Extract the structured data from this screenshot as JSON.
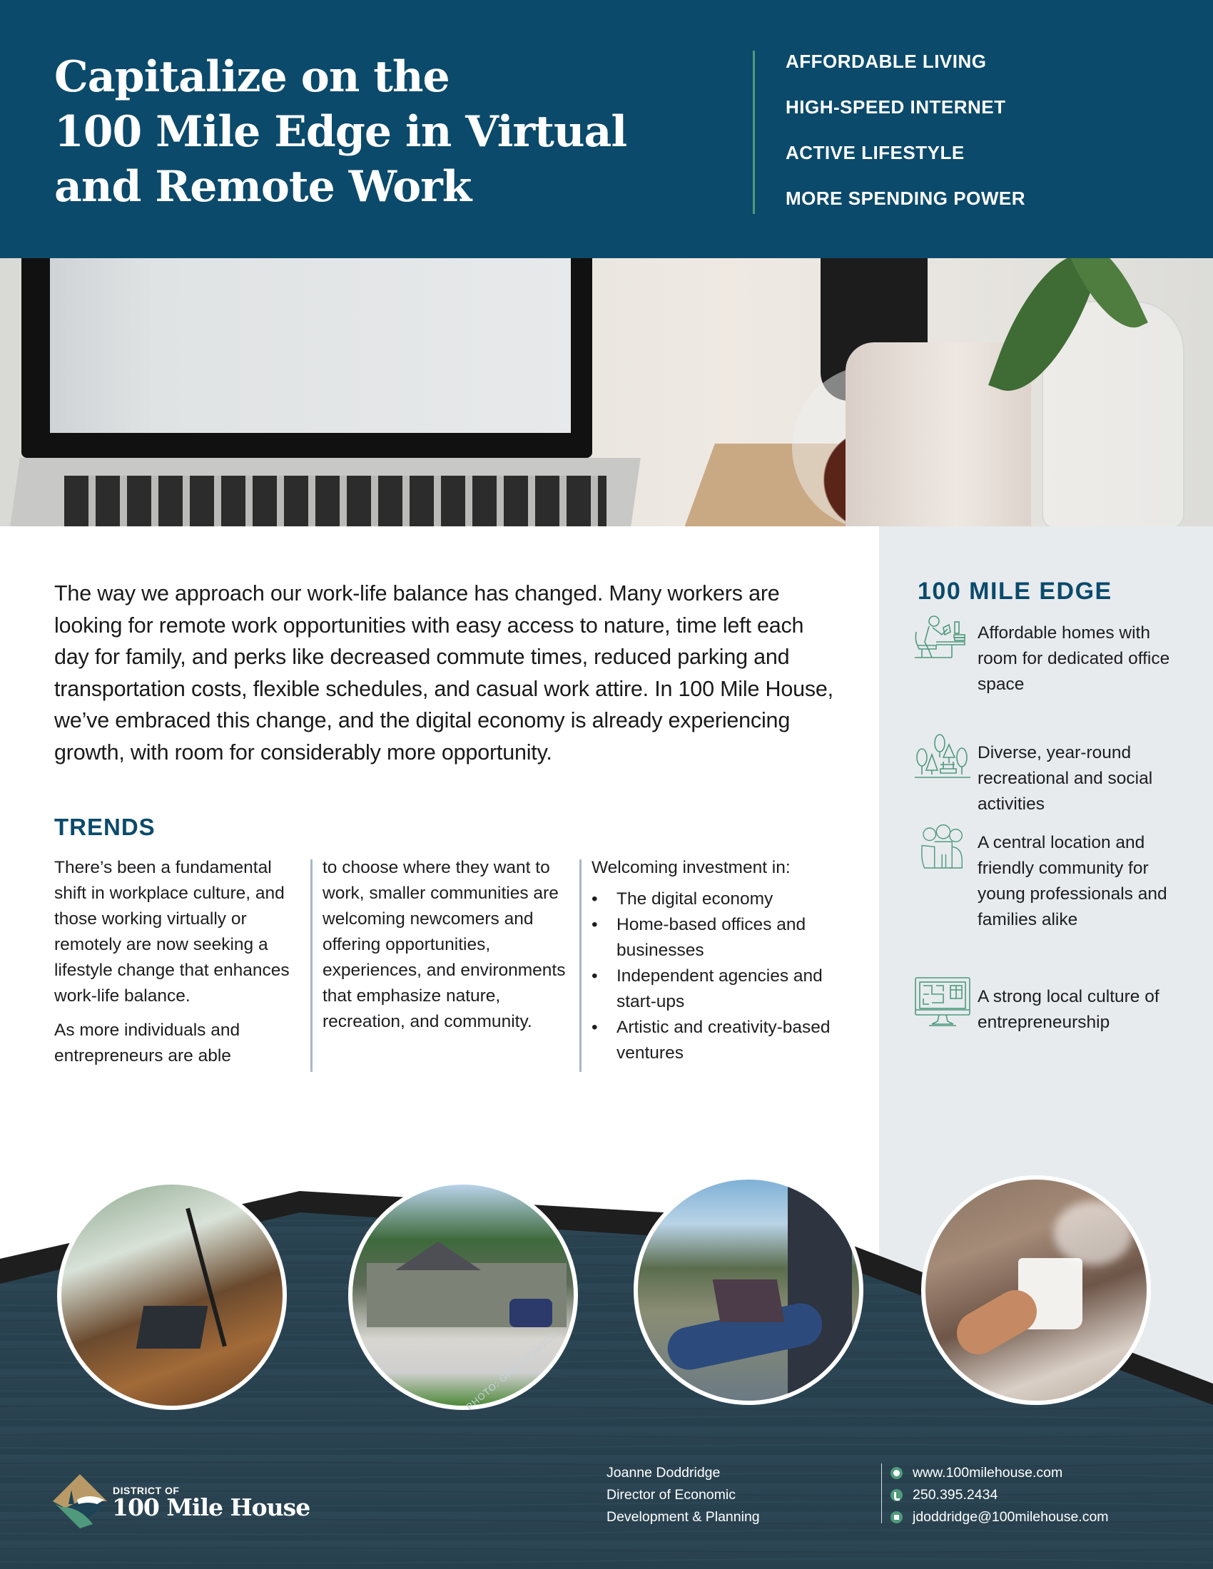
{
  "header": {
    "title_lines": [
      "Capitalize on the",
      "100 Mile Edge in Virtual",
      "and Remote Work"
    ],
    "tags": [
      "AFFORDABLE LIVING",
      "HIGH-SPEED INTERNET",
      "ACTIVE LIFESTYLE",
      "MORE SPENDING POWER"
    ],
    "colors": {
      "background": "#0b4a6b",
      "divider": "#4f9a7c"
    }
  },
  "hero": {
    "image": "laptop-coffee-desk-photo"
  },
  "intro": {
    "text": "The way we approach our work-life balance has changed. Many workers are looking for remote work opportunities with easy access to nature, time left each day for family, and perks like decreased commute times, reduced parking and transportation costs, flexible schedules, and casual work attire. In 100 Mile House, we’ve embraced this change, and the digital economy is already experiencing growth, with room for considerably more opportunity."
  },
  "trends": {
    "title": "TRENDS",
    "col1": [
      "There’s been a fundamental shift in workplace culture, and those working virtually or remotely are now seeking a lifestyle change that enhances work-life balance.",
      "As more individuals and entrepreneurs are able"
    ],
    "col2": "to choose where they want to work, smaller communities are welcoming newcomers and offering opportunities, experiences, and environments that emphasize nature, recreation, and community.",
    "col3": {
      "lead": "Welcoming investment in:",
      "items": [
        "The digital economy",
        "Home-based offices and businesses",
        "Independent agencies and start-ups",
        "Artistic and creativity-based ventures"
      ]
    }
  },
  "edge": {
    "title": "100 MILE EDGE",
    "items": [
      {
        "icon": "home-office-icon",
        "text": "Affordable homes with room for dedicated office space"
      },
      {
        "icon": "park-trees-icon",
        "text": "Diverse, year-round recreational and social activities"
      },
      {
        "icon": "family-icon",
        "text": "A central location and friendly community for young professionals and families alike"
      },
      {
        "icon": "computer-monitor-icon",
        "text": "A strong local culture of entrepreneurship"
      }
    ]
  },
  "photos": {
    "items": [
      "home-office-window-photo",
      "house-driveway-photo",
      "laptop-outdoors-photo",
      "coffee-mug-steam-photo"
    ],
    "credit": "PHOTO: GROCHOWICH"
  },
  "footer": {
    "logo_district": "DISTRICT OF",
    "logo_name": "100 Mile House",
    "contact_person": [
      "Joanne Doddridge",
      "Director of Economic",
      "Development & Planning"
    ],
    "website": "www.100milehouse.com",
    "phone": "250.395.2434",
    "email": "jdoddridge@100milehouse.com",
    "colors": {
      "wood": "#2b4554",
      "band": "#1e1e1e",
      "accent": "#4f9a7c"
    }
  }
}
